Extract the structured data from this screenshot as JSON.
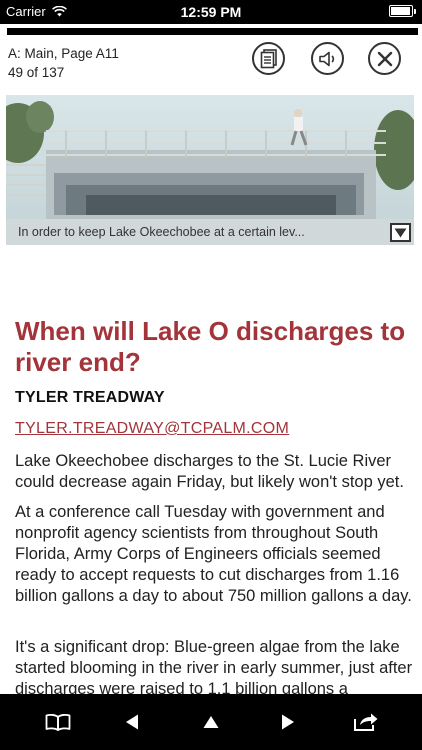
{
  "status_bar": {
    "carrier": "Carrier",
    "time": "12:59 PM",
    "battery_level": 0.95
  },
  "header": {
    "section": "A: Main, Page A11",
    "page_count": "49 of 137",
    "buttons": [
      {
        "name": "pages-icon"
      },
      {
        "name": "speaker-icon"
      },
      {
        "name": "close-icon"
      }
    ]
  },
  "photo": {
    "caption": "In order to keep Lake Okeechobee at a certain lev...",
    "toggle_icon": "triangle-down-icon"
  },
  "article": {
    "headline": "When will Lake O discharges to river end?",
    "author": "TYLER TREADWAY",
    "email": "TYLER.TREADWAY@TCPALM.COM",
    "paragraphs": [
      "Lake Okeechobee discharges to the St. Lucie River could decrease again Friday, but likely won't stop yet.",
      "At a conference call Tuesday with government and nonprofit agency scientists from throughout South Florida, Army Corps of Engineers officials seemed ready to accept requests to cut discharges from 1.16 billion gallons a day to about 750 million gallons a day.",
      "It's a significant drop: Blue-green algae from the lake started blooming in the river in early summer, just after discharges were raised to 1.1 billion gallons a"
    ]
  },
  "toolbar": {
    "icons": [
      "book-icon",
      "previous-icon",
      "up-icon",
      "next-icon",
      "share-icon"
    ]
  },
  "colors": {
    "accent": "#a2343a",
    "bars": "#000000"
  }
}
